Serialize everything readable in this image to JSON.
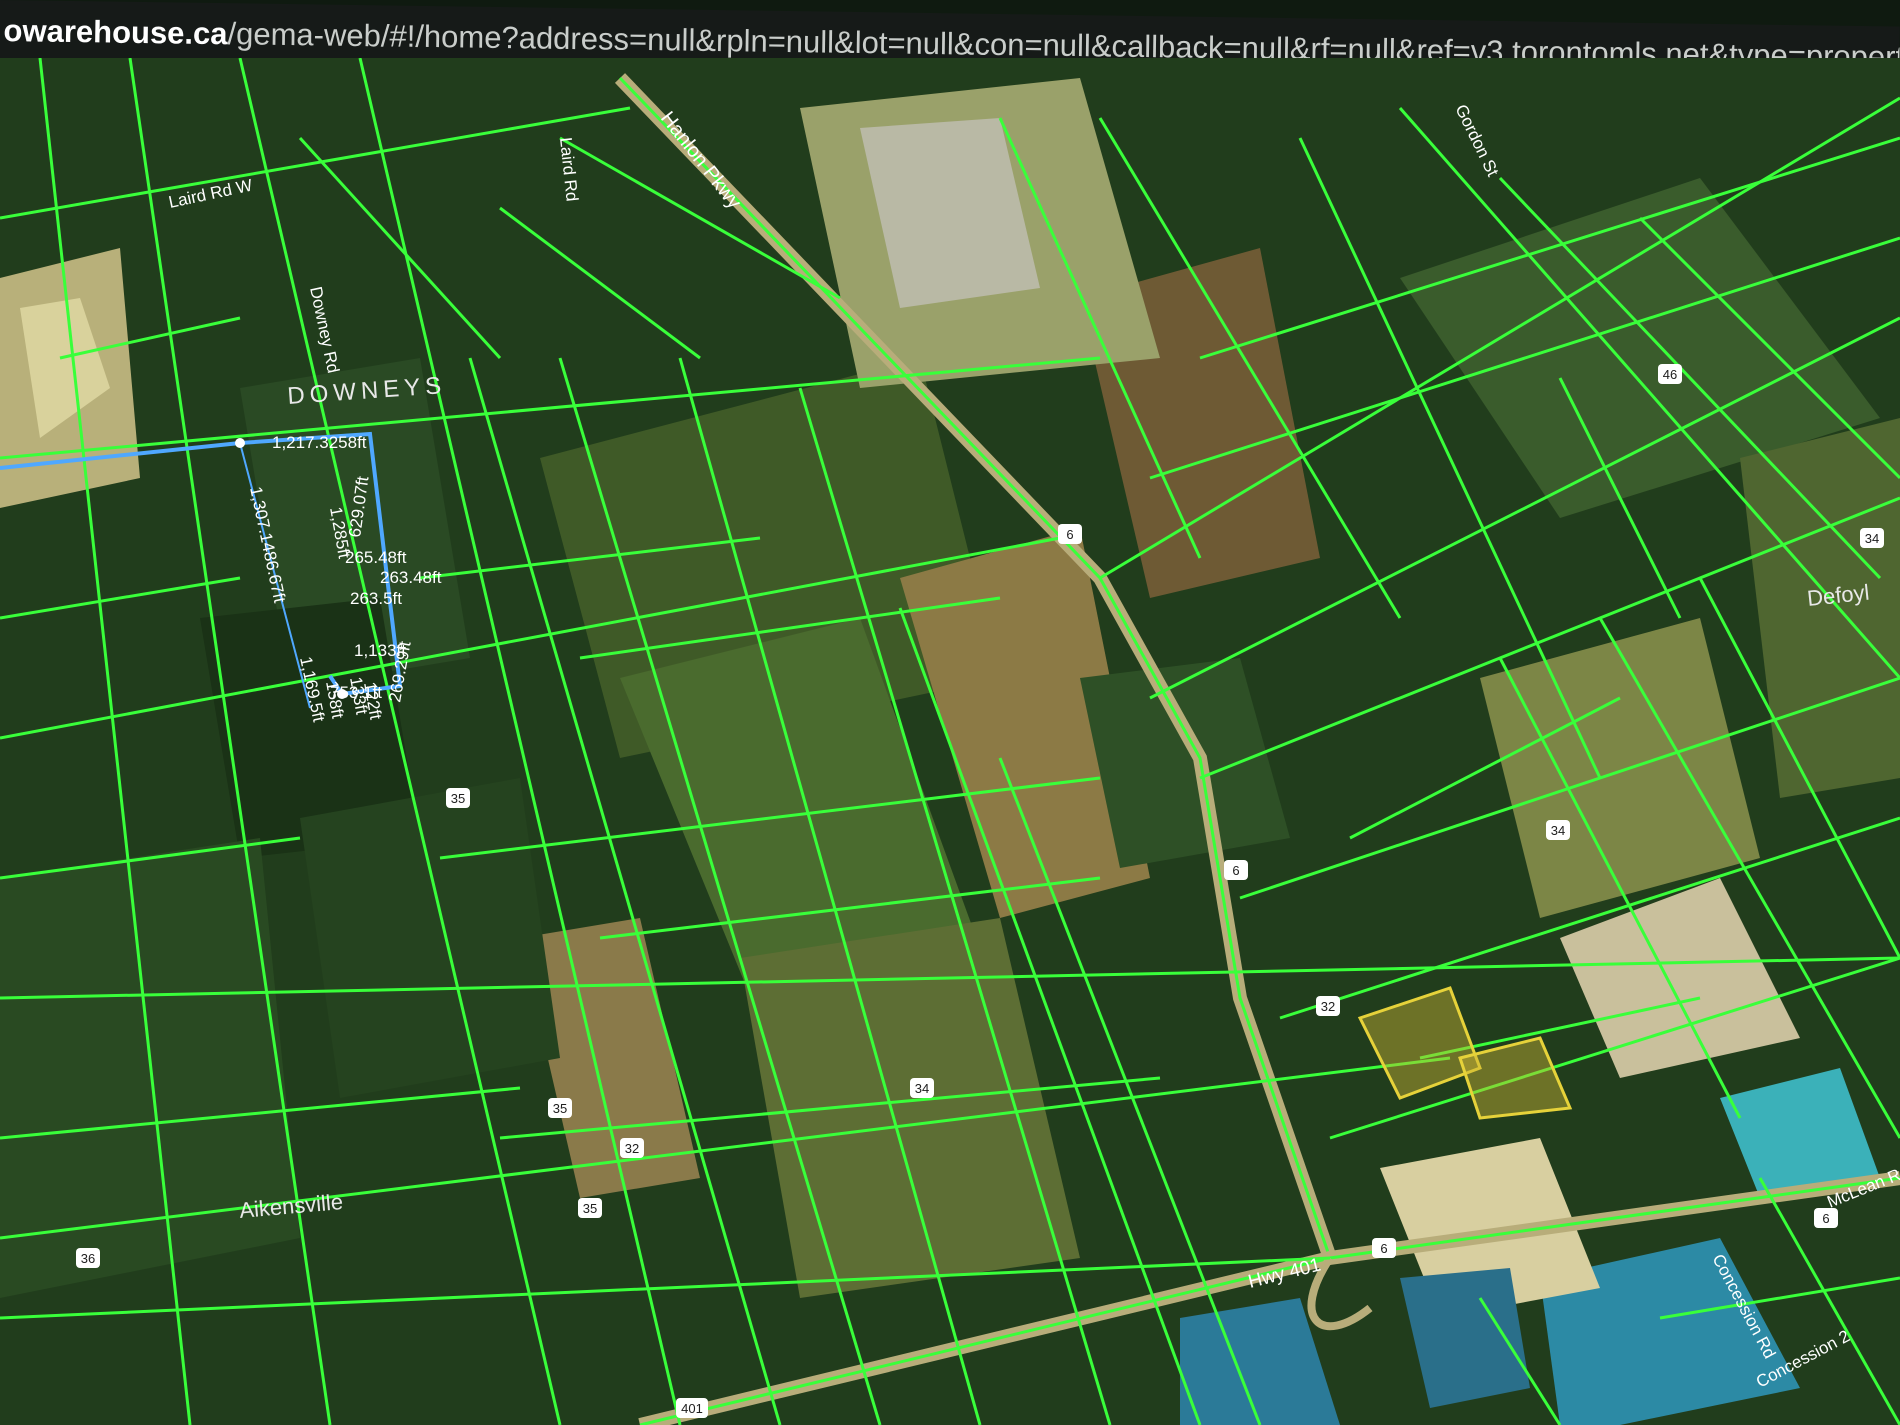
{
  "browser": {
    "url_domain": "owarehouse.ca",
    "url_path": "/gema-web/#!/home?address=null&rpln=null&lot=null&con=null&callback=null&rf=null&ref=v3.torontomls.net&type=propertyReport"
  },
  "colors": {
    "parcel_line": "#39ff3a",
    "selection": "#4fa8ff",
    "highlight": "#e6d23a",
    "terrain_dark": "#1c3a1a",
    "terrain_field": "#6d7b3d",
    "water": "#2a9bb0"
  },
  "map": {
    "roads": {
      "laird_rd_w": "Laird Rd W",
      "laird_rd": "Laird Rd",
      "hanlon_pkwy": "Hanlon Pkwy",
      "gordon_st": "Gordon St",
      "hwy_401": "Hwy 401",
      "downey_rd": "Downey Rd",
      "mclean_rd": "McLean Rd",
      "concession_rd": "Concession Rd",
      "concession_2": "Concession 2"
    },
    "places": {
      "downeys": "DOWNEYS",
      "aikensville": "Aikensville",
      "deforly": "Defoyl"
    },
    "shields": [
      "6",
      "6",
      "46",
      "34",
      "34",
      "6",
      "6",
      "401",
      "35",
      "35",
      "35",
      "32",
      "34",
      "32",
      "36"
    ],
    "measurements": [
      "1,217.3258ft",
      "1,307.1486.67ft",
      "1,169.5ft",
      "265.48ft",
      "263.48ft",
      "263.5ft",
      "629.07ft",
      "269.29ft",
      "1,133ft",
      "753.1ft",
      "158ft",
      "133ft",
      "122ft",
      "1,285ft"
    ]
  }
}
